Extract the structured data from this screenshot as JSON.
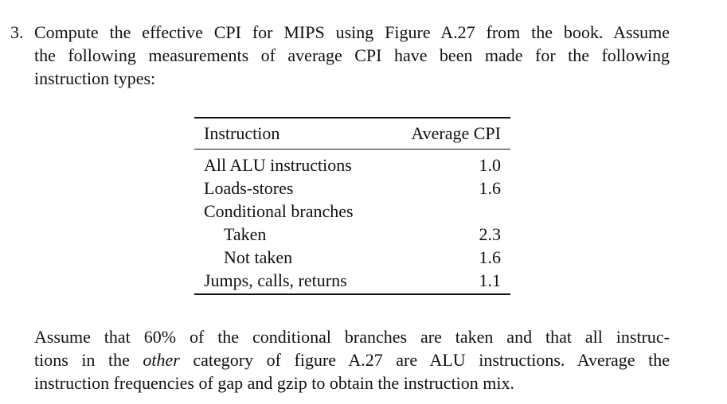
{
  "problem": {
    "number": "3.",
    "intro_lines": [
      "Compute the effective CPI for MIPS using Figure A.27 from the book. Assume",
      "the following measurements of average CPI have been made for the following",
      "instruction types:"
    ]
  },
  "table": {
    "headers": {
      "instruction": "Instruction",
      "cpi": "Average CPI"
    },
    "rows": [
      {
        "label": "All ALU instructions",
        "cpi": "1.0",
        "indent": false
      },
      {
        "label": "Loads-stores",
        "cpi": "1.6",
        "indent": false
      },
      {
        "label": "Conditional branches",
        "cpi": "",
        "indent": false
      },
      {
        "label": "Taken",
        "cpi": "2.3",
        "indent": true
      },
      {
        "label": "Not taken",
        "cpi": "1.6",
        "indent": true
      },
      {
        "label": "Jumps, calls, returns",
        "cpi": "1.1",
        "indent": false
      }
    ]
  },
  "followup": {
    "line1": "Assume that 60% of the conditional branches are taken and that all instruc-",
    "line2_pre": "tions in the ",
    "line2_em": "other",
    "line2_post": " category of figure A.27 are ALU instructions. Average the",
    "line3": "instruction frequencies of gap and gzip to obtain the instruction mix."
  }
}
